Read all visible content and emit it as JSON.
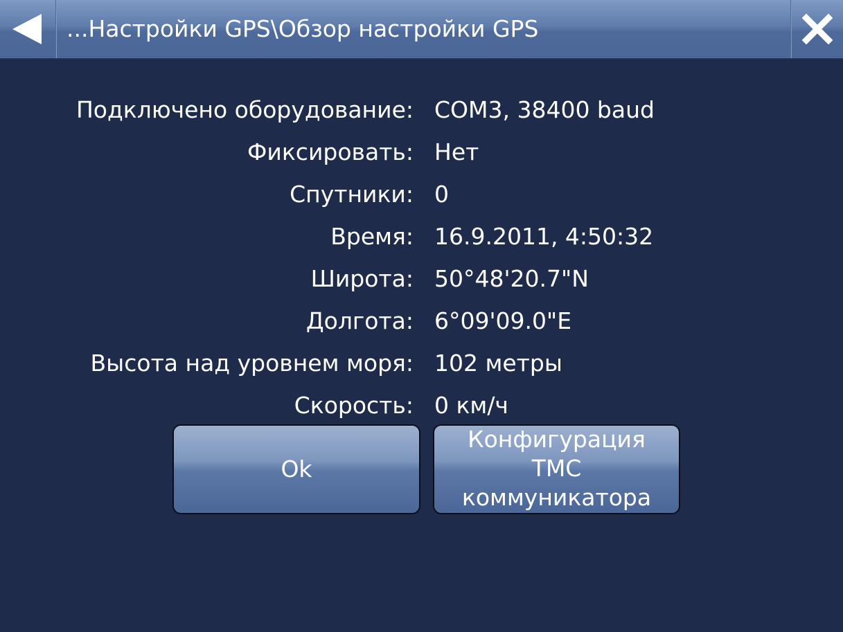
{
  "header": {
    "title": "...Настройки GPS\\Обзор настройки GPS",
    "back_icon": "left-arrow-icon",
    "close_icon": "close-x-icon"
  },
  "info": {
    "rows": [
      {
        "label": "Подключено оборудование:",
        "value": "COM3, 38400 baud"
      },
      {
        "label": "Фиксировать:",
        "value": "Нет"
      },
      {
        "label": "Спутники:",
        "value": "0"
      },
      {
        "label": "Время:",
        "value": "16.9.2011, 4:50:32"
      },
      {
        "label": "Широта:",
        "value": "50°48'20.7\"N"
      },
      {
        "label": "Долгота:",
        "value": "6°09'09.0\"E"
      },
      {
        "label": "Высота над уровнем моря:",
        "value": "102 метры"
      },
      {
        "label": "Скорость:",
        "value": "0 км/ч"
      }
    ]
  },
  "buttons": {
    "ok_label": "Ok",
    "tmc_label_lines": [
      "Конфигурация",
      "TMC",
      "коммуникатора"
    ]
  },
  "colors": {
    "background": "#1e2b4a",
    "title_bar": "#5f7cab",
    "text": "#ffffff"
  }
}
